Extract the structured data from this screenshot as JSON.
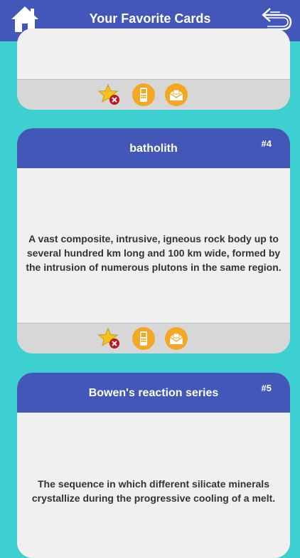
{
  "header": {
    "title": "Your Favorite Cards"
  },
  "cards": [
    {
      "term": "batholith",
      "number": "#4",
      "definition": "A vast composite, intrusive, igneous rock body up to several hundred km long and 100 km wide, formed by the intrusion of numerous plutons in the same region."
    },
    {
      "term": "Bowen's reaction series",
      "number": "#5",
      "definition": "The sequence in which different silicate minerals crystallize during the progressive cooling of a melt."
    }
  ],
  "icons": {
    "home": "home-icon",
    "back": "back-arrow-icon",
    "remove_favorite": "star-remove-icon",
    "phone": "phone-icon",
    "mail": "mail-icon"
  },
  "colors": {
    "background": "#3ecfd1",
    "header": "#4257b7",
    "card": "#f0f0f0",
    "footer": "#d7d7d7",
    "action_orange": "#f5a623",
    "star_yellow": "#f7c21b",
    "remove_red": "#c0151d"
  }
}
